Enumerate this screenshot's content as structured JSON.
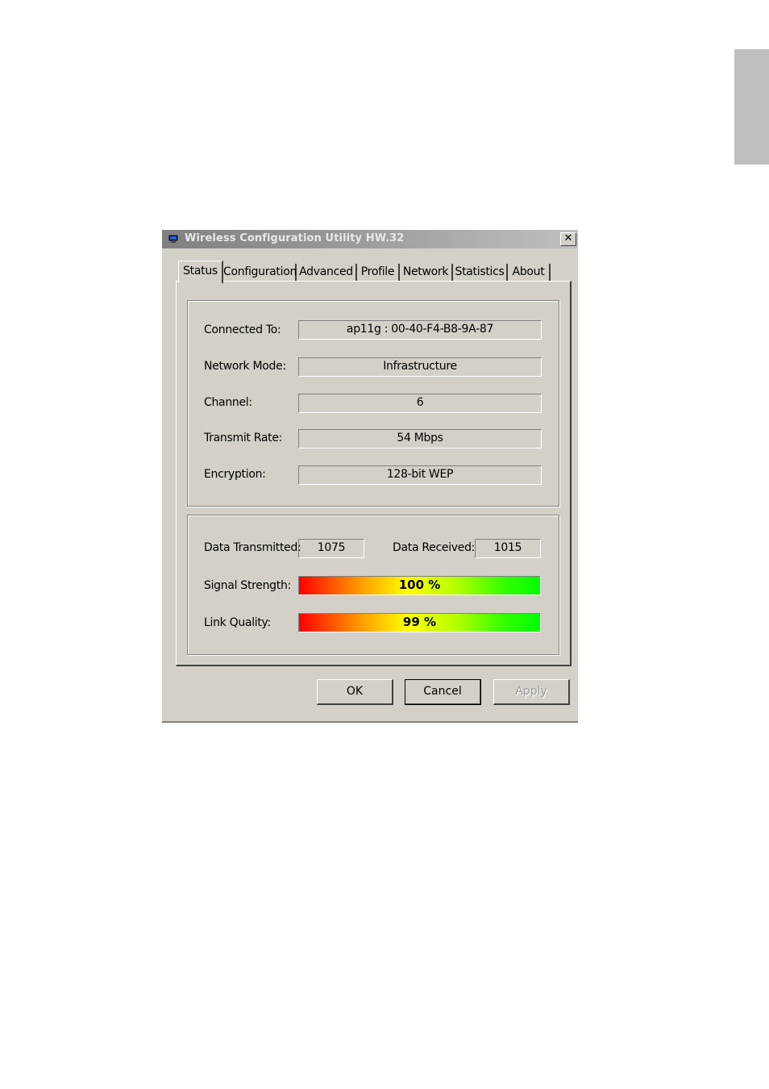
{
  "window": {
    "title": "Wireless Configuration Utility HW.32"
  },
  "tabs": [
    {
      "label": "Status",
      "active": true
    },
    {
      "label": "Configuration",
      "active": false
    },
    {
      "label": "Advanced",
      "active": false
    },
    {
      "label": "Profile",
      "active": false
    },
    {
      "label": "Network",
      "active": false
    },
    {
      "label": "Statistics",
      "active": false
    },
    {
      "label": "About",
      "active": false
    }
  ],
  "status": {
    "connected_to": {
      "label": "Connected To:",
      "value": "ap11g : 00-40-F4-B8-9A-87"
    },
    "network_mode": {
      "label": "Network Mode:",
      "value": "Infrastructure"
    },
    "channel": {
      "label": "Channel:",
      "value": "6"
    },
    "transmit_rate": {
      "label": "Transmit Rate:",
      "value": "54 Mbps"
    },
    "encryption": {
      "label": "Encryption:",
      "value": "128-bit WEP"
    }
  },
  "traffic": {
    "data_transmitted": {
      "label": "Data Transmitted:",
      "value": "1075"
    },
    "data_received": {
      "label": "Data Received:",
      "value": "1015"
    },
    "signal_strength": {
      "label": "Signal Strength:",
      "value_text": "100 %",
      "percent": 100
    },
    "link_quality": {
      "label": "Link Quality:",
      "value_text": "99 %",
      "percent": 99
    }
  },
  "buttons": {
    "ok": "OK",
    "cancel": "Cancel",
    "apply": "Apply"
  },
  "icons": {
    "window": "network-adapter-icon",
    "close": "close-icon"
  },
  "colors": {
    "window_bg": "#d4d0c8",
    "titlebar_inactive": "#808080",
    "side_tab": "#bfbfbf"
  }
}
